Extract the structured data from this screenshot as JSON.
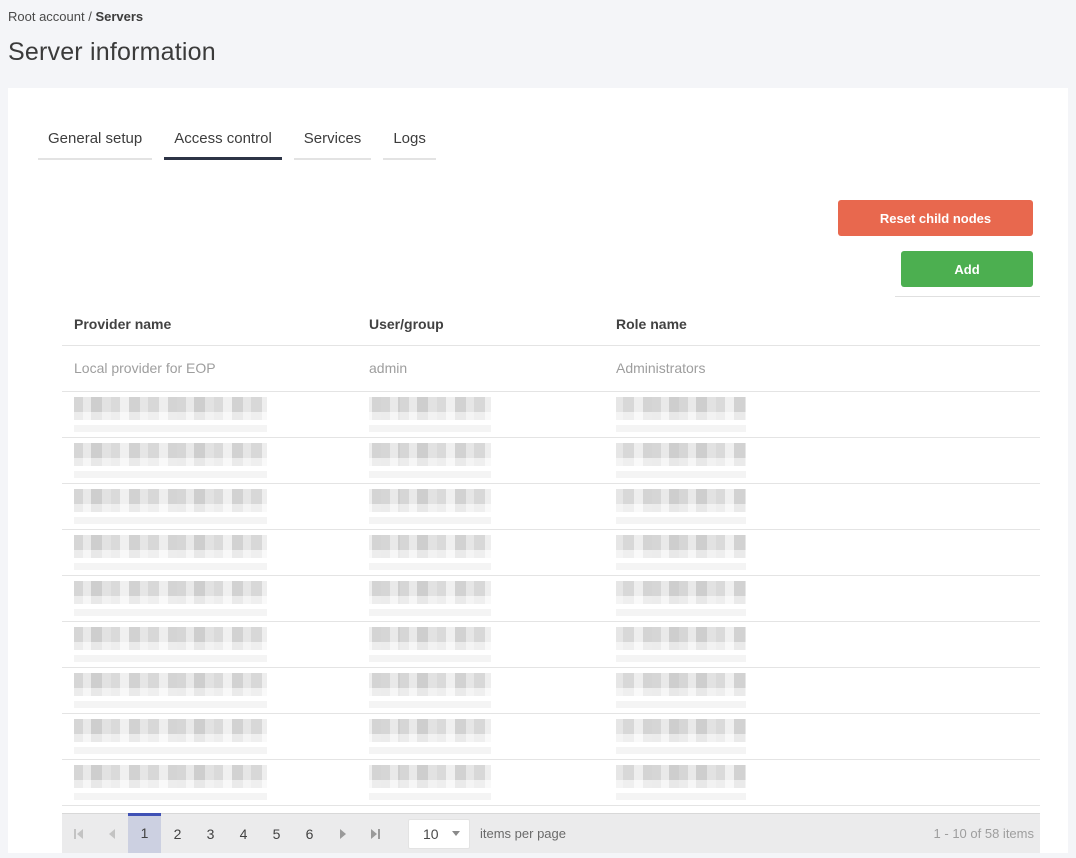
{
  "breadcrumb": {
    "root": "Root account",
    "separator": " / ",
    "current": "Servers"
  },
  "page_title": "Server information",
  "tabs": [
    {
      "label": "General setup",
      "active": false
    },
    {
      "label": "Access control",
      "active": true
    },
    {
      "label": "Services",
      "active": false
    },
    {
      "label": "Logs",
      "active": false
    }
  ],
  "toolbar": {
    "reset_button_label": "Reset child nodes",
    "add_button_label": "Add"
  },
  "table": {
    "columns": [
      "Provider name",
      "User/group",
      "Role name"
    ],
    "rows": [
      {
        "redacted": false,
        "provider": "Local provider for EOP",
        "user": "admin",
        "role": "Administrators"
      },
      {
        "redacted": true
      },
      {
        "redacted": true
      },
      {
        "redacted": true
      },
      {
        "redacted": true
      },
      {
        "redacted": true
      },
      {
        "redacted": true
      },
      {
        "redacted": true
      },
      {
        "redacted": true
      },
      {
        "redacted": true
      }
    ]
  },
  "pager": {
    "pages": [
      "1",
      "2",
      "3",
      "4",
      "5",
      "6"
    ],
    "current_page": "1",
    "page_size": "10",
    "items_per_page_label": "items per page",
    "summary": "1 - 10 of 58 items"
  },
  "colors": {
    "reset_button": "#e8684e",
    "add_button": "#4caf50",
    "active_tab_underline": "#2d3446",
    "selected_page_accent": "#3f51b5",
    "selected_page_bg": "#ccd0e1",
    "page_background": "#f4f5f8"
  }
}
